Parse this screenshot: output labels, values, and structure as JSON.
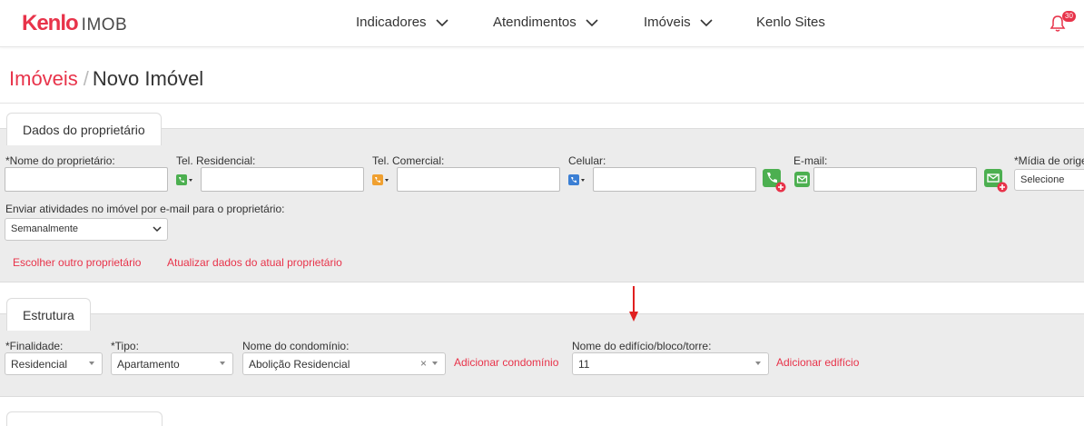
{
  "brand": {
    "name": "Kenlo",
    "product": "IMOB"
  },
  "nav": {
    "items": [
      {
        "label": "Indicadores"
      },
      {
        "label": "Atendimentos"
      },
      {
        "label": "Imóveis"
      },
      {
        "label": "Kenlo Sites"
      }
    ],
    "notifications_count": "30"
  },
  "breadcrumb": {
    "parent": "Imóveis",
    "separator": "/",
    "current": "Novo Imóvel"
  },
  "owner_section": {
    "tab_label": "Dados do proprietário",
    "fields": {
      "owner_name": {
        "label": "*Nome do proprietário:",
        "value": ""
      },
      "home_phone": {
        "label": "Tel. Residencial:",
        "value": ""
      },
      "work_phone": {
        "label": "Tel. Comercial:",
        "value": ""
      },
      "mobile": {
        "label": "Celular:",
        "value": ""
      },
      "email": {
        "label": "E-mail:",
        "value": ""
      },
      "media_origin": {
        "label": "*Mídia de origem",
        "value": "Selecione"
      }
    },
    "activity_email": {
      "label": "Enviar atividades no imóvel por e-mail para o proprietário:",
      "value": "Semanalmente"
    },
    "links": {
      "choose_other": "Escolher outro proprietário",
      "update_current": "Atualizar dados do atual proprietário"
    }
  },
  "structure_section": {
    "tab_label": "Estrutura",
    "fields": {
      "purpose": {
        "label": "*Finalidade:",
        "value": "Residencial"
      },
      "type": {
        "label": "*Tipo:",
        "value": "Apartamento"
      },
      "condo": {
        "label": "Nome do condomínio:",
        "value": "Abolição Residencial"
      },
      "building": {
        "label": "Nome do edifício/bloco/torre:",
        "value": "11"
      }
    },
    "links": {
      "add_condo": "Adicionar condomínio",
      "add_building": "Adicionar edifício"
    }
  },
  "colors": {
    "accent": "#e8334a",
    "green": "#4caf50",
    "orange": "#f0a030",
    "blue": "#3b7fd4",
    "arrow": "#e02020"
  }
}
